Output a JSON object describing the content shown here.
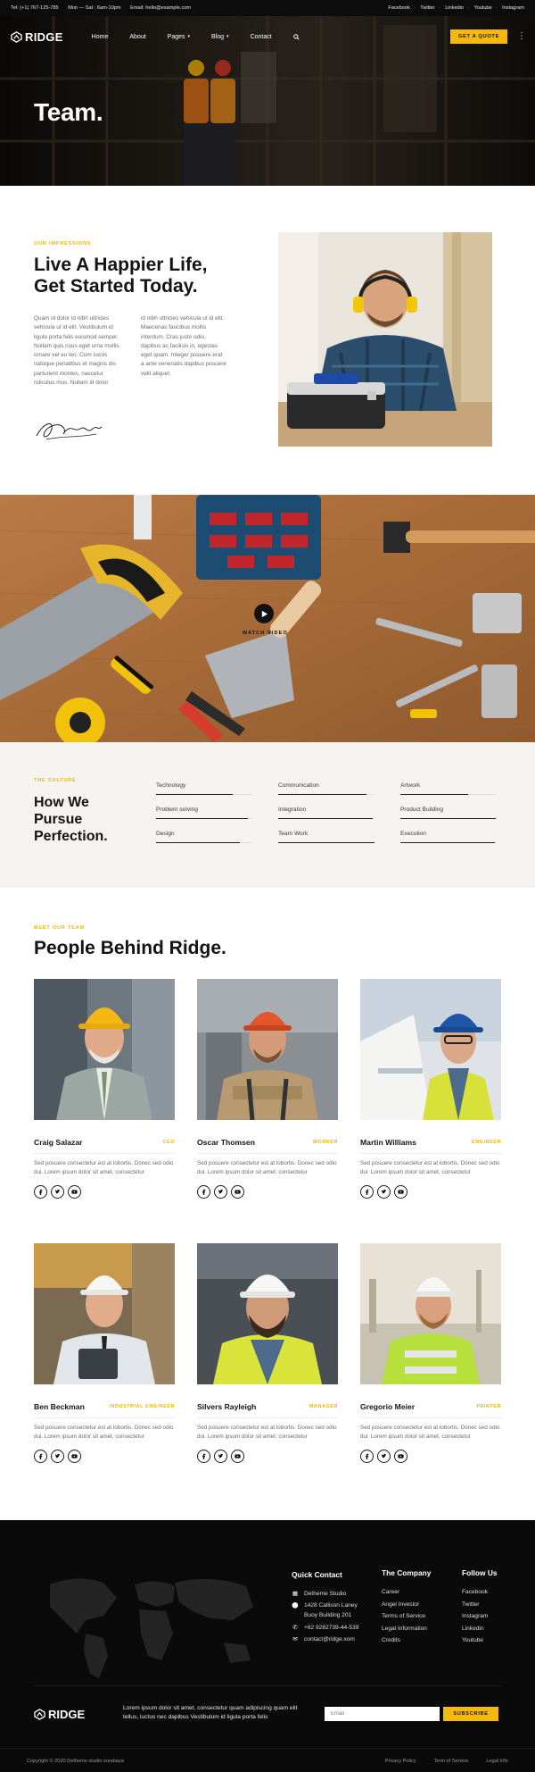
{
  "topbar": {
    "tel": "Tel: (+1) 767-125-785",
    "hours": "Mon — Sat : 6am-10pm",
    "email": "Email: hello@example.com",
    "socials": [
      "Facebook",
      "Twitter",
      "Linkedin",
      "Youtube",
      "Instagram"
    ]
  },
  "nav": {
    "logo": "RIDGE",
    "menu": [
      "Home",
      "About",
      "Pages",
      "Blog",
      "Contact"
    ],
    "quote_button": "GET A QUOTE"
  },
  "hero": {
    "title": "Team."
  },
  "about": {
    "eyebrow": "OUR IMPRESSIONS",
    "heading_line1": "Live A Happier Life,",
    "heading_line2": "Get Started Today.",
    "col1": "Quam id dolor id nibh ultricies vehicula ut id elit. Vestibulum id ligula porta felis euismod semper. Nullam quis risus eget urna mollis ornare vel eu leo. Cum sociis natoque penatibus et magnis dis parturient montes, nascetur ridiculus mus. Nullam id dolor",
    "col2": "id nibh ultricies vehicula ut id elit. Maecenas faucibus mollis interdum. Cras justo odio, dapibus ac facilisis in, egestas eget quam. Integer posuere erat a ante venenatis dapibus posuere velit aliquet."
  },
  "video": {
    "label": "WATCH VIDEO"
  },
  "culture": {
    "eyebrow": "THE CULTURE",
    "heading_line1": "How We",
    "heading_line2": "Pursue",
    "heading_line3": "Perfection.",
    "skills": [
      {
        "label": "Technology",
        "level": 0.8
      },
      {
        "label": "Communication",
        "level": 0.92
      },
      {
        "label": "Artwork",
        "level": 0.7
      },
      {
        "label": "Problem solving",
        "level": 0.95
      },
      {
        "label": "Integration",
        "level": 0.98
      },
      {
        "label": "Product Building",
        "level": 0.99
      },
      {
        "label": "Design",
        "level": 0.87
      },
      {
        "label": "Team Work",
        "level": 1.0
      },
      {
        "label": "Execution",
        "level": 0.98
      }
    ]
  },
  "team": {
    "eyebrow": "MEET OUR TEAM",
    "heading": "People Behind Ridge.",
    "members": [
      {
        "name": "Craig Salazar",
        "role": "CEO",
        "desc": "Sed posuere consectetur est at lobortis. Donec sed odio dui. Lorem ipsum dolor sit amet, consectetur"
      },
      {
        "name": "Oscar Thomsen",
        "role": "WORKER",
        "desc": "Sed posuere consectetur est at lobortis. Donec sed odio dui. Lorem ipsum dolor sit amet, consectetur"
      },
      {
        "name": "Martin Williams",
        "role": "ENGINEER",
        "desc": "Sed posuere consectetur est at lobortis. Donec sed odio dui. Lorem ipsum dolor sit amet, consectetur"
      },
      {
        "name": "Ben Beckman",
        "role": "INDUSTRIAL ENGINEER",
        "desc": "Sed posuere consectetur est at lobortis. Donec sed odio dui. Lorem ipsum dolor sit amet, consectetur"
      },
      {
        "name": "Silvers Rayleigh",
        "role": "MANAGER",
        "desc": "Sed posuere consectetur est at lobortis. Donec sed odio dui. Lorem ipsum dolor sit amet, consectetur"
      },
      {
        "name": "Gregorio Meier",
        "role": "PAINTER",
        "desc": "Sed posuere consectetur est at lobortis. Donec sed odio dui. Lorem ipsum dolor sit amet, consectetur"
      }
    ]
  },
  "footer": {
    "quick_contact": {
      "title": "Quick Contact",
      "studio": "Detheme Studio",
      "address_line1": "1428 Callison Laney",
      "address_line2": "Buoy Building 201",
      "phone": "+62 9282739-44-539",
      "email": "contact@ridge.xom"
    },
    "company": {
      "title": "The Company",
      "links": [
        "Career",
        "Angel Investor",
        "Terms of Service",
        "Legal Information",
        "Credits"
      ]
    },
    "follow": {
      "title": "Follow Us",
      "links": [
        "Facebook",
        "Twitter",
        "Instagram",
        "Linkedin",
        "Youtube"
      ]
    },
    "logo": "RIDGE",
    "description": "Lorem ipsum dolor sit amet, consectetur quam adipiscing quam elit tellus, luctus nec dapibus Vestibulum id ligula porta felis",
    "email_placeholder": "Email",
    "subscribe": "SUBSCRIBE",
    "copyright": "Copyright © 2020 Detheme studio surabaya",
    "legal": [
      "Privacy Policy",
      "Term of Service",
      "Legal Info"
    ]
  },
  "colors": {
    "accent": "#f5b80b",
    "dark": "#0c0c0c",
    "culture_bg": "#f5f4f1"
  },
  "icons": [
    "logo-icon",
    "chevron-down-icon",
    "search-icon",
    "kebab-menu-icon",
    "signature-icon",
    "play-icon",
    "facebook-icon",
    "twitter-icon",
    "youtube-icon",
    "building-icon",
    "pin-icon",
    "phone-icon",
    "mail-icon",
    "world-map"
  ]
}
